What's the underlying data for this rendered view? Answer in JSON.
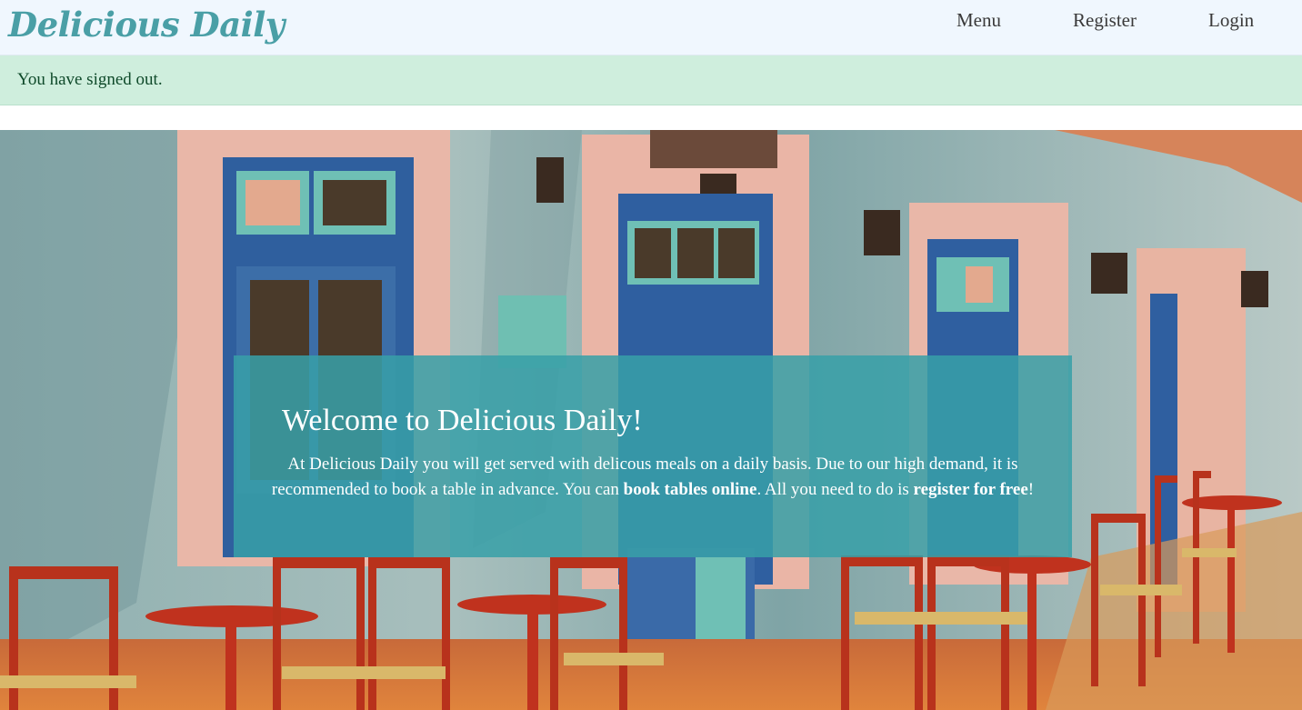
{
  "navbar": {
    "brand": "Delicious Daily",
    "links": {
      "menu": "Menu",
      "register": "Register",
      "login": "Login"
    }
  },
  "alert": {
    "message": "You have signed out."
  },
  "hero": {
    "image_desc": "cafe bar storefront with red chairs",
    "welcome": {
      "title": "Welcome to Delicious Daily!",
      "body_part1": "At Delicious Daily you will get served with delicous meals on a daily basis. Due to our high demand, it is recommended to book a table in advance. You can ",
      "book_link": "book tables online",
      "body_part2": ". All you need to do is ",
      "register_link": "register for free",
      "body_part3": "!"
    }
  },
  "colors": {
    "brand": "#4a9fa6",
    "navbar_bg": "#f0f7fe",
    "alert_bg": "#cfeedd",
    "alert_text": "#0f4a2a",
    "welcome_box": "#38a0a8"
  }
}
